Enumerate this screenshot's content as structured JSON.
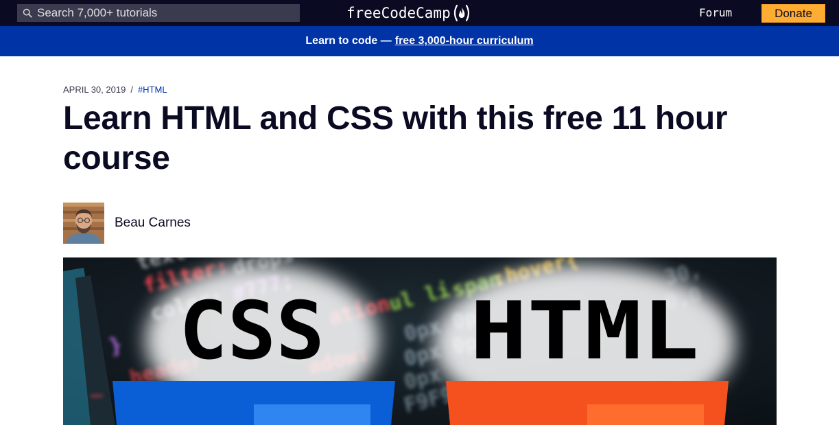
{
  "nav": {
    "search_placeholder": "Search 7,000+ tutorials",
    "brand": "freeCodeCamp",
    "forum_label": "Forum",
    "donate_label": "Donate"
  },
  "banner": {
    "text": "Learn to code —",
    "link_text": "free 3,000-hour curriculum"
  },
  "article": {
    "date": "APRIL 30, 2019",
    "separator": "/",
    "tag": "#HTML",
    "title": "Learn HTML and CSS with this free 11 hour course",
    "author": "Beau Carnes"
  },
  "hero": {
    "css_label": "CSS",
    "html_label": "HTML"
  },
  "colors": {
    "nav_bg": "#0a0a23",
    "banner_bg": "#0033a6",
    "donate_bg": "#feac32",
    "css_blue": "#0a5fd6",
    "html_orange": "#f4511e"
  },
  "icons": {
    "search": "search-icon",
    "flame": "fcc-flame-icon"
  }
}
